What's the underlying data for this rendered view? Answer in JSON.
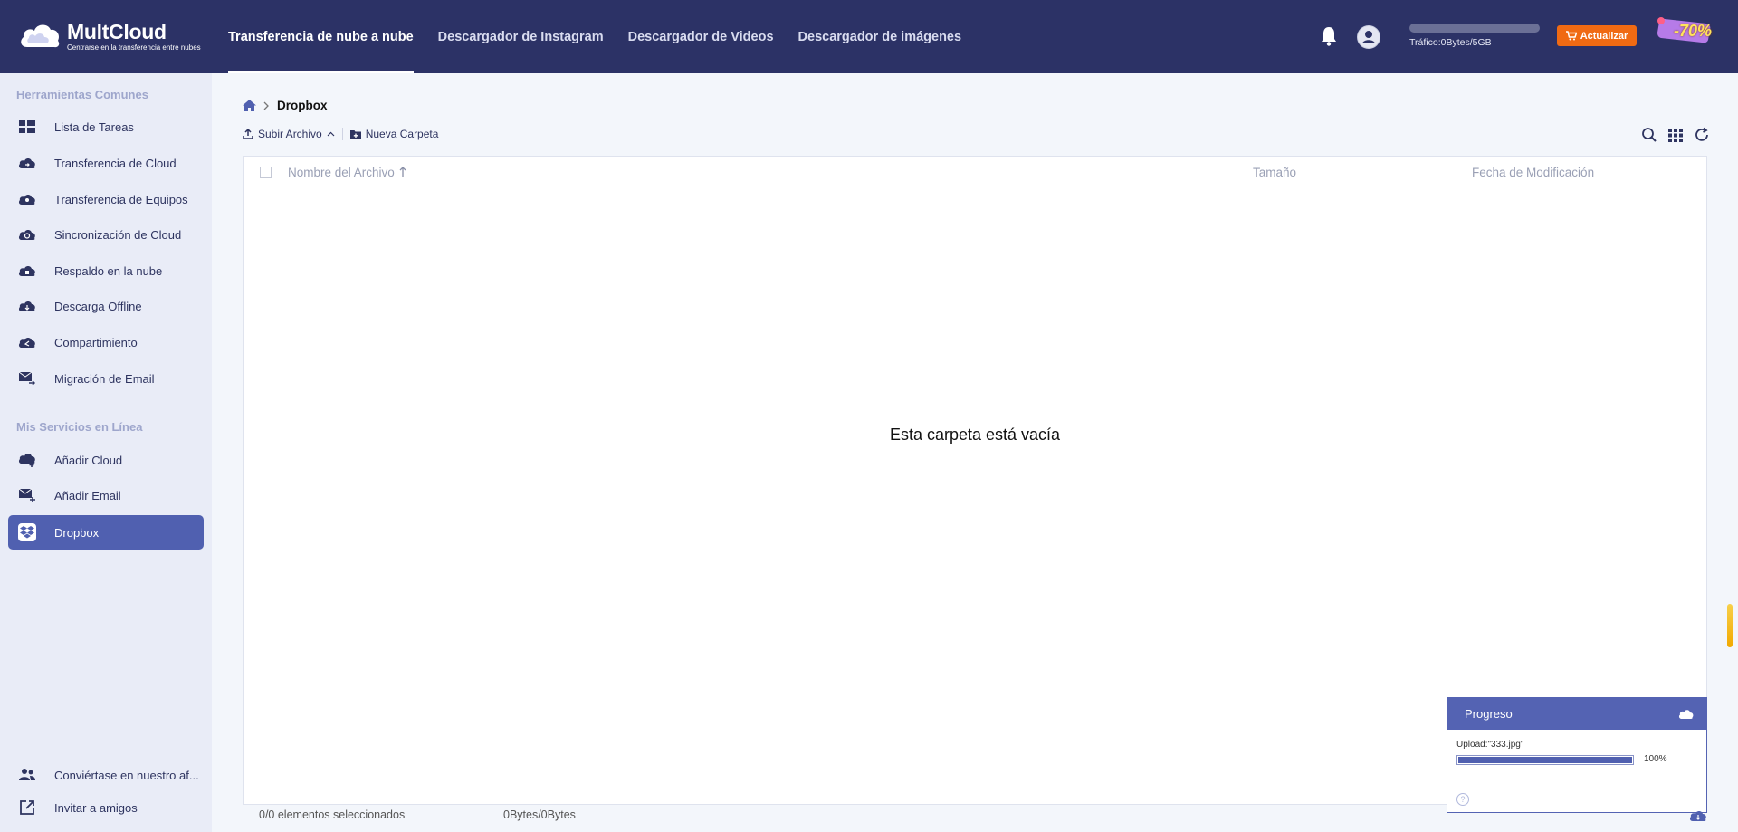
{
  "brand": {
    "name": "MultCloud",
    "tagline": "Centrarse en la transferencia entre nubes"
  },
  "nav": [
    {
      "label": "Transferencia de nube a nube",
      "active": true
    },
    {
      "label": "Descargador de Instagram"
    },
    {
      "label": "Descargador de Videos"
    },
    {
      "label": "Descargador de imágenes"
    }
  ],
  "header": {
    "traffic": "Tráfico:0Bytes/5GB",
    "upgrade_label": "Actualizar",
    "promo": "-70%"
  },
  "sidebar": {
    "section_common": "Herramientas Comunes",
    "common": [
      {
        "label": "Lista de Tareas",
        "icon": "grid-icon"
      },
      {
        "label": "Transferencia de Cloud",
        "icon": "cloud-transfer-icon"
      },
      {
        "label": "Transferencia de Equipos",
        "icon": "team-transfer-icon"
      },
      {
        "label": "Sincronización de Cloud",
        "icon": "cloud-sync-icon"
      },
      {
        "label": "Respaldo en la nube",
        "icon": "cloud-backup-icon"
      },
      {
        "label": "Descarga Offline",
        "icon": "offline-download-icon"
      },
      {
        "label": "Compartimiento",
        "icon": "share-icon"
      },
      {
        "label": "Migración de Email",
        "icon": "email-migration-icon"
      }
    ],
    "section_services": "Mis Servicios en Línea",
    "services": [
      {
        "label": "Añadir Cloud",
        "icon": "add-cloud-icon"
      },
      {
        "label": "Añadir Email",
        "icon": "add-email-icon"
      },
      {
        "label": "Dropbox",
        "icon": "dropbox-icon",
        "active": true
      }
    ],
    "bottom": [
      {
        "label": "Conviértase en nuestro af...",
        "icon": "affiliate-icon"
      },
      {
        "label": "Invitar a amigos",
        "icon": "invite-icon"
      }
    ]
  },
  "breadcrumb": {
    "current": "Dropbox"
  },
  "toolbar": {
    "upload_label": "Subir Archivo",
    "new_folder_label": "Nueva Carpeta"
  },
  "table": {
    "col_name": "Nombre del Archivo",
    "col_size": "Tamaño",
    "col_date": "Fecha de Modificación",
    "empty_message": "Esta carpeta está vacía"
  },
  "footer": {
    "selected": "0/0 elementos seleccionados",
    "size": "0Bytes/0Bytes"
  },
  "progress": {
    "title": "Progreso",
    "file": "Upload:\"333.jpg\"",
    "percent_label": "100%",
    "percent": 100
  }
}
